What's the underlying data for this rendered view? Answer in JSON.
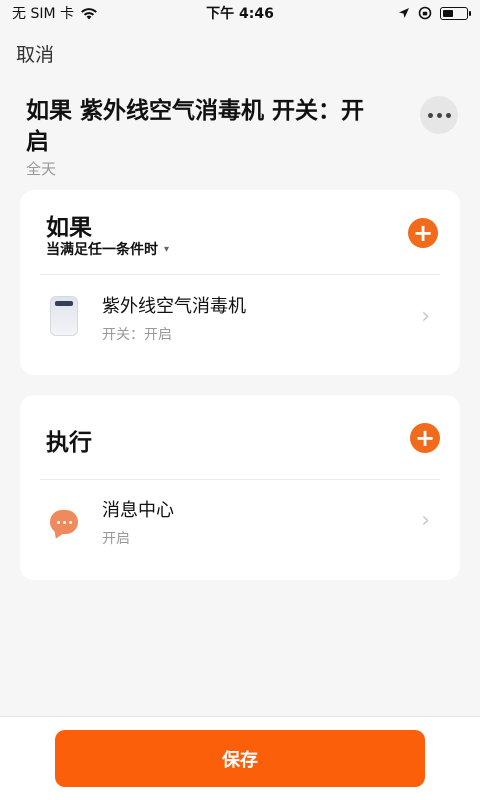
{
  "status_bar": {
    "carrier": "无 SIM 卡",
    "time": "下午 4:46"
  },
  "header": {
    "cancel_label": "取消",
    "title": "如果 紫外线空气消毒机 开关：开启",
    "subtitle": "全天"
  },
  "if_section": {
    "heading": "如果",
    "condition_mode": "当满足任一条件时",
    "items": [
      {
        "title": "紫外线空气消毒机",
        "subtitle": "开关：开启"
      }
    ]
  },
  "do_section": {
    "heading": "执行",
    "items": [
      {
        "title": "消息中心",
        "subtitle": "开启"
      }
    ]
  },
  "footer": {
    "save_label": "保存"
  },
  "colors": {
    "accent": "#f26a1b",
    "save_button": "#fb5f0a",
    "background": "#f6f6f6"
  }
}
